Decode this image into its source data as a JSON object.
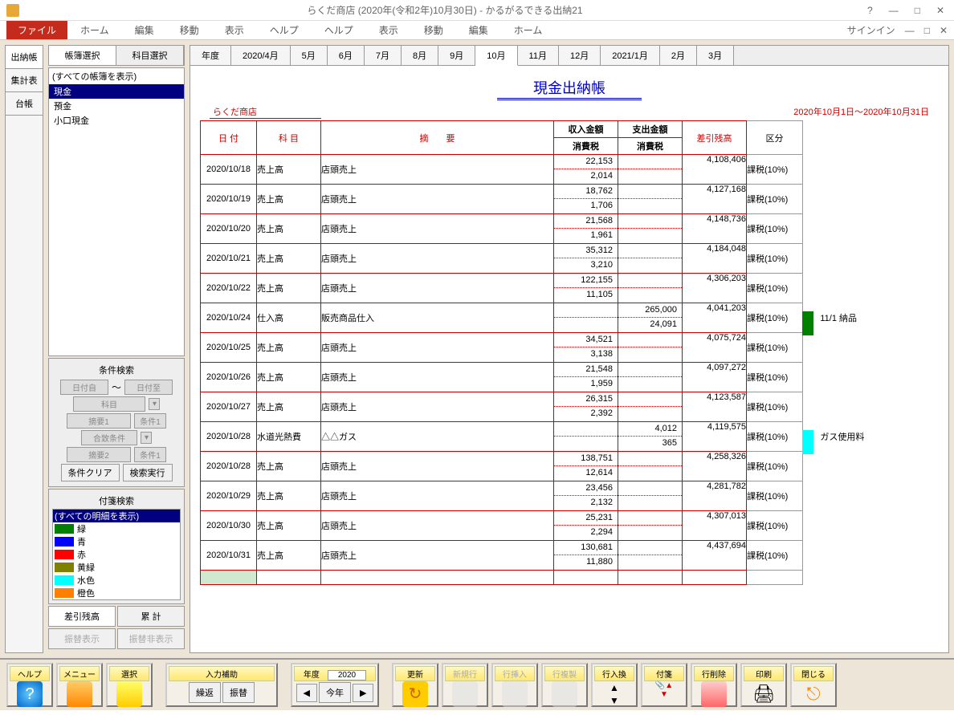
{
  "titlebar": {
    "text": "らくだ商店 (2020年(令和2年)10月30日) - かるがるできる出納21",
    "help": "?",
    "min": "—",
    "max": "□",
    "close": "✕"
  },
  "ribbon": {
    "file": "ファイル",
    "tabs": [
      "ホーム",
      "編集",
      "移動",
      "表示",
      "ヘルプ"
    ],
    "signin": "サインイン"
  },
  "leftTabs": [
    "出納帳",
    "集計表",
    "台帳"
  ],
  "sidebarTabs": [
    "帳簿選択",
    "科目選択"
  ],
  "ledgerList": {
    "header": "(すべての帳簿を表示)",
    "items": [
      "現金",
      "預金",
      "小口現金"
    ],
    "selected": 0
  },
  "search": {
    "title": "条件検索",
    "dateFrom": "日付自",
    "dateTo": "日付至",
    "tilde": "～",
    "subject": "科目",
    "desc1": "摘要1",
    "cond1": "条件1",
    "match": "合致条件",
    "desc2": "摘要2",
    "clear": "条件クリア",
    "exec": "検索実行"
  },
  "tags": {
    "title": "付箋検索",
    "header": "(すべての明細を表示)",
    "items": [
      {
        "c": "#008000",
        "l": "緑"
      },
      {
        "c": "#0000ff",
        "l": "青"
      },
      {
        "c": "#ff0000",
        "l": "赤"
      },
      {
        "c": "#808000",
        "l": "黄緑"
      },
      {
        "c": "#00ffff",
        "l": "水色"
      },
      {
        "c": "#ff8000",
        "l": "橙色"
      }
    ]
  },
  "bottomBtns": {
    "bal": "差引残高",
    "total": "累 計",
    "show": "振替表示",
    "hide": "振替非表示"
  },
  "periodTabs": [
    "年度",
    "2020/4月",
    "5月",
    "6月",
    "7月",
    "8月",
    "9月",
    "10月",
    "11月",
    "12月",
    "2021/1月",
    "2月",
    "3月"
  ],
  "periodActive": 7,
  "ledger": {
    "title": "現金出納帳",
    "shop": "らくだ商店",
    "period": "2020年10月1日～2020年10月31日",
    "headers": {
      "date": "日 付",
      "subj": "科 目",
      "desc": "摘　　要",
      "in": "収入金額",
      "inTax": "消費税",
      "out": "支出金額",
      "outTax": "消費税",
      "bal": "差引残高",
      "cat": "区分"
    },
    "rows": [
      {
        "date": "2020/10/18",
        "subj": "売上高",
        "desc": "店頭売上",
        "in": "22,153",
        "inTax": "2,014",
        "out": "",
        "outTax": "",
        "bal": "4,108,406",
        "cat": "課税(10%)"
      },
      {
        "date": "2020/10/19",
        "subj": "売上高",
        "desc": "店頭売上",
        "in": "18,762",
        "inTax": "1,706",
        "out": "",
        "outTax": "",
        "bal": "4,127,168",
        "cat": "課税(10%)"
      },
      {
        "date": "2020/10/20",
        "subj": "売上高",
        "desc": "店頭売上",
        "in": "21,568",
        "inTax": "1,961",
        "out": "",
        "outTax": "",
        "bal": "4,148,736",
        "cat": "課税(10%)"
      },
      {
        "date": "2020/10/21",
        "subj": "売上高",
        "desc": "店頭売上",
        "in": "35,312",
        "inTax": "3,210",
        "out": "",
        "outTax": "",
        "bal": "4,184,048",
        "cat": "課税(10%)"
      },
      {
        "date": "2020/10/22",
        "subj": "売上高",
        "desc": "店頭売上",
        "in": "122,155",
        "inTax": "11,105",
        "out": "",
        "outTax": "",
        "bal": "4,306,203",
        "cat": "課税(10%)"
      },
      {
        "date": "2020/10/24",
        "subj": "仕入高",
        "desc": "販売商品仕入",
        "in": "",
        "inTax": "",
        "out": "265,000",
        "outTax": "24,091",
        "bal": "4,041,203",
        "cat": "課税(10%)",
        "tag": "#008000",
        "note": "11/1 納品"
      },
      {
        "date": "2020/10/25",
        "subj": "売上高",
        "desc": "店頭売上",
        "in": "34,521",
        "inTax": "3,138",
        "out": "",
        "outTax": "",
        "bal": "4,075,724",
        "cat": "課税(10%)"
      },
      {
        "date": "2020/10/26",
        "subj": "売上高",
        "desc": "店頭売上",
        "in": "21,548",
        "inTax": "1,959",
        "out": "",
        "outTax": "",
        "bal": "4,097,272",
        "cat": "課税(10%)"
      },
      {
        "date": "2020/10/27",
        "subj": "売上高",
        "desc": "店頭売上",
        "in": "26,315",
        "inTax": "2,392",
        "out": "",
        "outTax": "",
        "bal": "4,123,587",
        "cat": "課税(10%)"
      },
      {
        "date": "2020/10/28",
        "subj": "水道光熱費",
        "desc": "△△ガス",
        "in": "",
        "inTax": "",
        "out": "4,012",
        "outTax": "365",
        "bal": "4,119,575",
        "cat": "課税(10%)",
        "tag": "#00ffff",
        "note": "ガス使用料"
      },
      {
        "date": "2020/10/28",
        "subj": "売上高",
        "desc": "店頭売上",
        "in": "138,751",
        "inTax": "12,614",
        "out": "",
        "outTax": "",
        "bal": "4,258,326",
        "cat": "課税(10%)"
      },
      {
        "date": "2020/10/29",
        "subj": "売上高",
        "desc": "店頭売上",
        "in": "23,456",
        "inTax": "2,132",
        "out": "",
        "outTax": "",
        "bal": "4,281,782",
        "cat": "課税(10%)"
      },
      {
        "date": "2020/10/30",
        "subj": "売上高",
        "desc": "店頭売上",
        "in": "25,231",
        "inTax": "2,294",
        "out": "",
        "outTax": "",
        "bal": "4,307,013",
        "cat": "課税(10%)"
      },
      {
        "date": "2020/10/31",
        "subj": "売上高",
        "desc": "店頭売上",
        "in": "130,681",
        "inTax": "11,880",
        "out": "",
        "outTax": "",
        "bal": "4,437,694",
        "cat": "課税(10%)"
      }
    ]
  },
  "toolbar": {
    "help": "ヘルプ",
    "menu": "メニュー",
    "select": "選択",
    "input": "入力補助",
    "repeat": "繰返",
    "transfer": "振替",
    "year": "年度",
    "yearVal": "2020",
    "thisYear": "今年",
    "update": "更新",
    "newRow": "新規行",
    "insRow": "行挿入",
    "dupRow": "行複製",
    "swapRow": "行入換",
    "tag": "付箋",
    "delRow": "行削除",
    "print": "印刷",
    "close": "閉じる"
  }
}
